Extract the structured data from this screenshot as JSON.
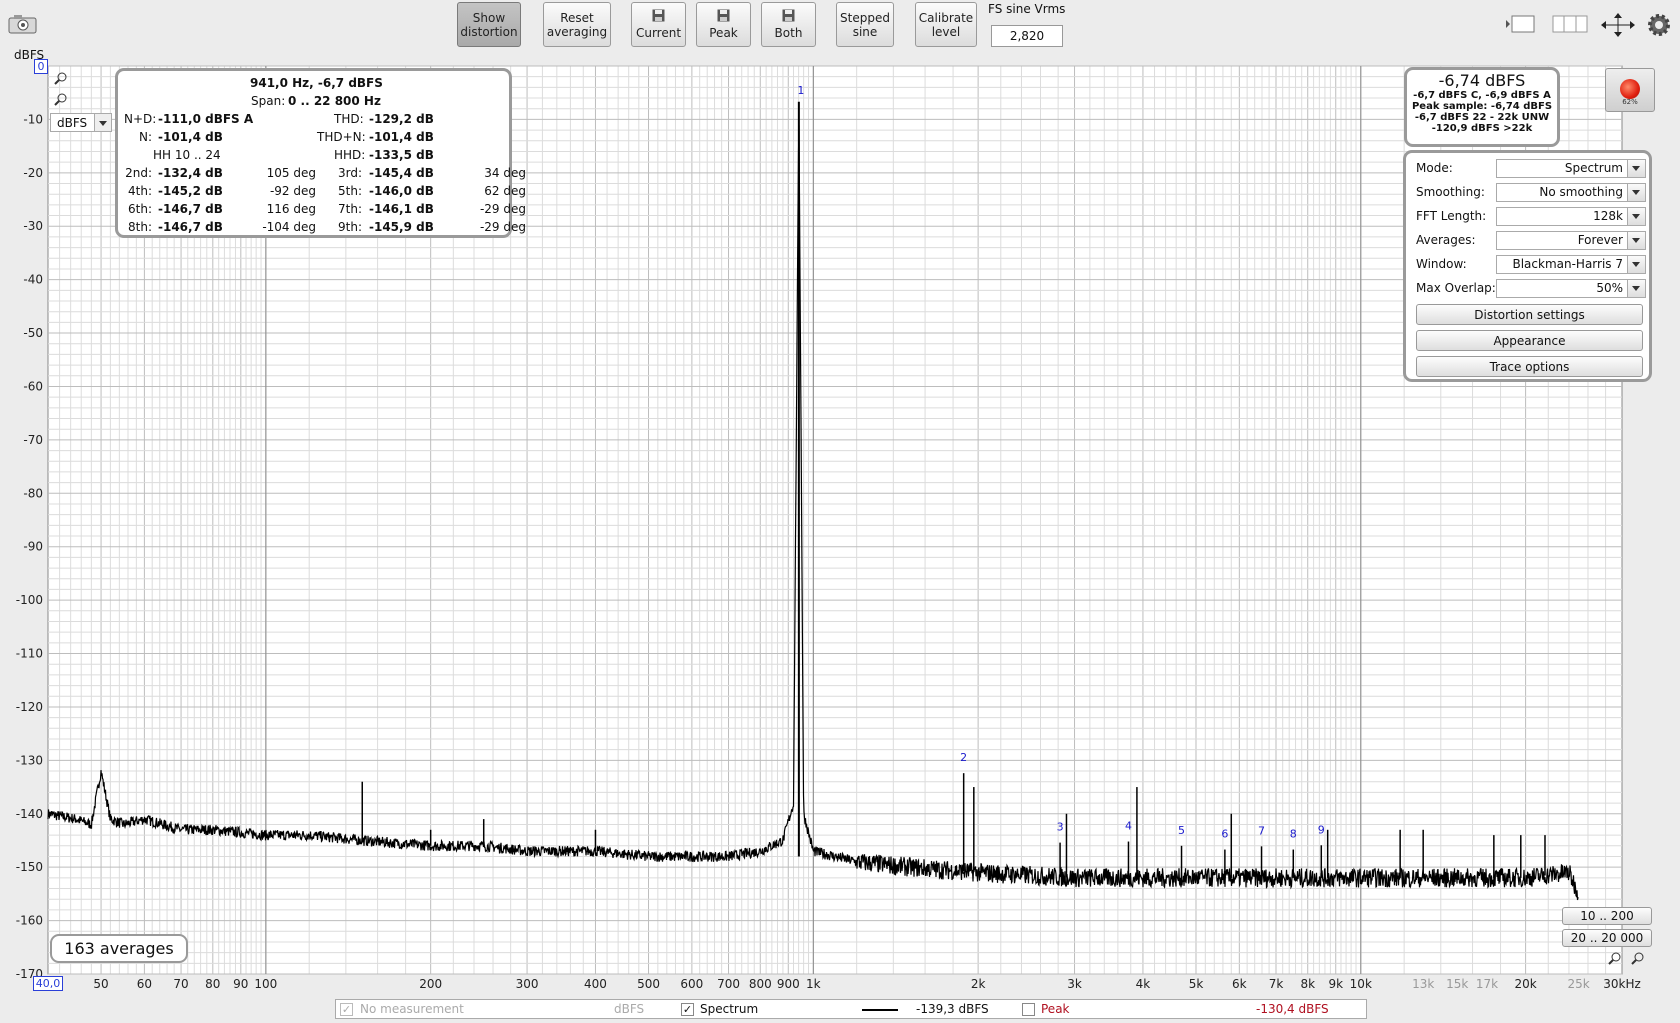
{
  "toolbar": {
    "show_distortion": "Show\ndistortion",
    "reset_averaging": "Reset\naveraging",
    "current": "Current",
    "peak": "Peak",
    "both": "Both",
    "stepped_sine": "Stepped\nsine",
    "calibrate_level": "Calibrate\nlevel",
    "fs_label": "FS sine Vrms",
    "fs_value": "2,820"
  },
  "axis": {
    "unit_label": "dBFS",
    "unit_select": "dBFS",
    "top_value": "0",
    "x_start": "40,0",
    "y_ticks": [
      "-10",
      "-20",
      "-30",
      "-40",
      "-50",
      "-60",
      "-70",
      "-80",
      "-90",
      "-100",
      "-110",
      "-120",
      "-130",
      "-140",
      "-150",
      "-160",
      "-170"
    ],
    "x_ticks": [
      "50",
      "60",
      "70",
      "80",
      "90",
      "100",
      "200",
      "300",
      "400",
      "500",
      "600",
      "700",
      "800",
      "900",
      "1k",
      "2k",
      "3k",
      "4k",
      "5k",
      "6k",
      "7k",
      "8k",
      "9k",
      "10k",
      "13k",
      "15k",
      "17k",
      "20k",
      "25k",
      "30kHz"
    ]
  },
  "distortion": {
    "header": "941,0 Hz, -6,7 dBFS",
    "span_label": "Span:",
    "span_value": "0 .. 22 800 Hz",
    "nd_label": "N+D:",
    "nd_value": "-111,0 dBFS A",
    "thd_label": "THD:",
    "thd_value": "-129,2 dB",
    "n_label": "N:",
    "n_value": "-101,4 dB",
    "thdn_label": "THD+N:",
    "thdn_value": "-101,4 dB",
    "hh_label": "HH 10 .. 24",
    "hhd_label": "HHD:",
    "hhd_value": "-133,5 dB",
    "harmonics": [
      {
        "label": "2nd:",
        "value": "-132,4 dB",
        "phase": "105 deg"
      },
      {
        "label": "3rd:",
        "value": "-145,4 dB",
        "phase": "34 deg"
      },
      {
        "label": "4th:",
        "value": "-145,2 dB",
        "phase": "-92 deg"
      },
      {
        "label": "5th:",
        "value": "-146,0 dB",
        "phase": "62 deg"
      },
      {
        "label": "6th:",
        "value": "-146,7 dB",
        "phase": "116 deg"
      },
      {
        "label": "7th:",
        "value": "-146,1 dB",
        "phase": "-29 deg"
      },
      {
        "label": "8th:",
        "value": "-146,7 dB",
        "phase": "-104 deg"
      },
      {
        "label": "9th:",
        "value": "-145,9 dB",
        "phase": "-29 deg"
      }
    ]
  },
  "level": {
    "main": "-6,74 dBFS",
    "line1": "-6,7 dBFS C, -6,9 dBFS A",
    "line2": "Peak sample: -6,74 dBFS",
    "line3": "-6,7 dBFS 22 - 22k UNW",
    "line4": "-120,9 dBFS >22k",
    "record_pct": "62%"
  },
  "settings": {
    "mode_label": "Mode:",
    "mode_value": "Spectrum",
    "smoothing_label": "Smoothing:",
    "smoothing_value": "No  smoothing",
    "fft_label": "FFT Length:",
    "fft_value": "128k",
    "averages_label": "Averages:",
    "averages_value": "Forever",
    "window_label": "Window:",
    "window_value": "Blackman-Harris 7",
    "overlap_label": "Max Overlap:",
    "overlap_value": "50%",
    "distortion_settings": "Distortion settings",
    "appearance": "Appearance",
    "trace_options": "Trace options"
  },
  "zoom": {
    "range1": "10 .. 200",
    "range2": "20 .. 20 000"
  },
  "averages_badge": "163 averages",
  "legend": {
    "no_measurement": "No measurement",
    "no_measurement_unit": "dBFS",
    "spectrum": "Spectrum",
    "spectrum_value": "-139,3 dBFS",
    "peak": "Peak",
    "peak_value": "-130,4 dBFS"
  },
  "colors": {
    "trace": "#000000",
    "marker": "#1a1acc",
    "peak": "#b01020",
    "grid_major": "#bdbdbd",
    "grid_minor": "#dcdcdc"
  },
  "chart_data": {
    "type": "line",
    "xscale": "log",
    "xlim": [
      40,
      30000
    ],
    "ylim": [
      -170,
      0
    ],
    "ylabel": "dBFS",
    "series": [
      {
        "name": "Spectrum",
        "x": [
          40,
          45,
          48,
          50,
          52,
          55,
          60,
          70,
          80,
          100,
          120,
          150,
          200,
          250,
          300,
          400,
          500,
          600,
          700,
          800,
          880,
          920,
          941,
          960,
          1000,
          1200,
          1500,
          2000,
          3000,
          4000,
          6000,
          10000,
          15000,
          20000,
          24000,
          25000
        ],
        "y": [
          -140,
          -141,
          -142,
          -132,
          -141,
          -142,
          -141,
          -143,
          -143,
          -144,
          -144,
          -145,
          -146,
          -146,
          -147,
          -147,
          -148,
          -148,
          -148,
          -147,
          -145,
          -138,
          -6.7,
          -140,
          -147,
          -149,
          -150,
          -151,
          -152,
          -152,
          -152,
          -152,
          -152,
          -152,
          -151,
          -155
        ]
      }
    ],
    "harmonic_markers": [
      {
        "n": "1",
        "freq": 941,
        "level": -6.7
      },
      {
        "n": "2",
        "freq": 1882,
        "level": -132.4
      },
      {
        "n": "3",
        "freq": 2823,
        "level": -145.4
      },
      {
        "n": "4",
        "freq": 3764,
        "level": -145.2
      },
      {
        "n": "5",
        "freq": 4705,
        "level": -146.0
      },
      {
        "n": "6",
        "freq": 5646,
        "level": -146.7
      },
      {
        "n": "7",
        "freq": 6587,
        "level": -146.1
      },
      {
        "n": "8",
        "freq": 7528,
        "level": -146.7
      },
      {
        "n": "9",
        "freq": 8469,
        "level": -145.9
      }
    ],
    "spurs": [
      {
        "freq": 150,
        "level": -134
      },
      {
        "freq": 200,
        "level": -143
      },
      {
        "freq": 250,
        "level": -141
      },
      {
        "freq": 400,
        "level": -143
      },
      {
        "freq": 1964,
        "level": -135
      },
      {
        "freq": 2900,
        "level": -140
      },
      {
        "freq": 3900,
        "level": -135
      },
      {
        "freq": 5800,
        "level": -140
      },
      {
        "freq": 8700,
        "level": -143
      },
      {
        "freq": 11800,
        "level": -143
      },
      {
        "freq": 13000,
        "level": -143
      },
      {
        "freq": 17500,
        "level": -144
      },
      {
        "freq": 19600,
        "level": -144
      },
      {
        "freq": 21700,
        "level": -144
      }
    ]
  }
}
